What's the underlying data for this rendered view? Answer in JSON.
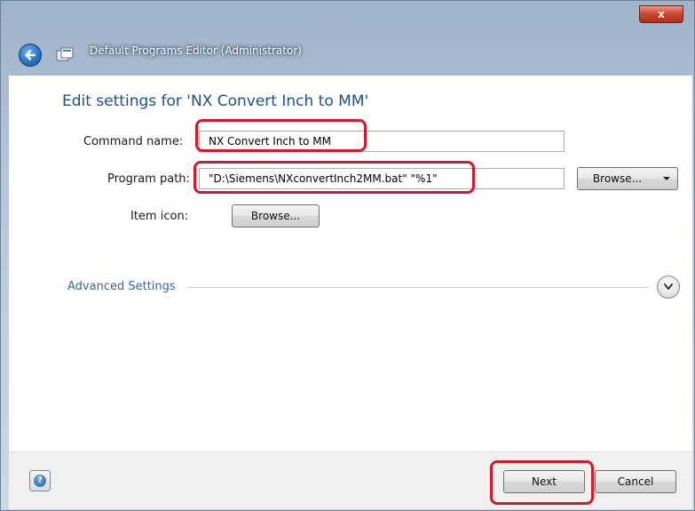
{
  "window": {
    "title": "Default Programs Editor (Administrator)",
    "close_glyph": "x",
    "colors": {
      "heading": "#1e4f8f",
      "highlight": "#d11a2a",
      "link": "#3a63a8"
    }
  },
  "main": {
    "heading": "Edit settings for 'NX Convert Inch to MM'",
    "command_name": {
      "label": "Command name:",
      "value": "NX Convert Inch to MM"
    },
    "program_path": {
      "label": "Program path:",
      "value": "\"D:\\Siemens\\NXconvertInch2MM.bat\" \"%1\"",
      "browse_label": "Browse..."
    },
    "item_icon": {
      "label": "Item icon:",
      "browse_label": "Browse..."
    },
    "advanced": {
      "label": "Advanced Settings"
    }
  },
  "footer": {
    "help_glyph": "?",
    "next_label": "Next",
    "cancel_label": "Cancel"
  },
  "icons": {
    "back": "back-arrow-icon",
    "app": "default-programs-icon",
    "dropdown": "chevron-down-icon",
    "expand": "chevron-down-icon",
    "help": "help-icon"
  }
}
